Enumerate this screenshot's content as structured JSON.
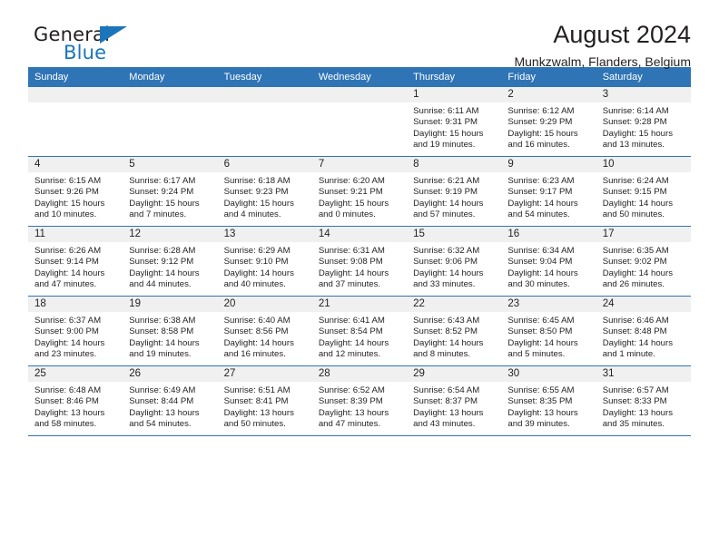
{
  "logo": {
    "text_top": "General",
    "text_bottom": "Blue",
    "triangle_color": "#1b75bb",
    "top_color": "#231f20",
    "bottom_color": "#1b75bb"
  },
  "header": {
    "title": "August 2024",
    "subtitle": "Munkzwalm, Flanders, Belgium"
  },
  "colors": {
    "header_blue": "#2f74b5",
    "daynum_band": "#f0f0f0",
    "text": "#231f20"
  },
  "weekday_headers": [
    "Sunday",
    "Monday",
    "Tuesday",
    "Wednesday",
    "Thursday",
    "Friday",
    "Saturday"
  ],
  "weeks": [
    [
      {
        "day": "",
        "empty": true,
        "sunrise": "",
        "sunset": "",
        "daylight": ""
      },
      {
        "day": "",
        "empty": true,
        "sunrise": "",
        "sunset": "",
        "daylight": ""
      },
      {
        "day": "",
        "empty": true,
        "sunrise": "",
        "sunset": "",
        "daylight": ""
      },
      {
        "day": "",
        "empty": true,
        "sunrise": "",
        "sunset": "",
        "daylight": ""
      },
      {
        "day": "1",
        "empty": false,
        "sunrise": "Sunrise: 6:11 AM",
        "sunset": "Sunset: 9:31 PM",
        "daylight": "Daylight: 15 hours and 19 minutes."
      },
      {
        "day": "2",
        "empty": false,
        "sunrise": "Sunrise: 6:12 AM",
        "sunset": "Sunset: 9:29 PM",
        "daylight": "Daylight: 15 hours and 16 minutes."
      },
      {
        "day": "3",
        "empty": false,
        "sunrise": "Sunrise: 6:14 AM",
        "sunset": "Sunset: 9:28 PM",
        "daylight": "Daylight: 15 hours and 13 minutes."
      }
    ],
    [
      {
        "day": "4",
        "empty": false,
        "sunrise": "Sunrise: 6:15 AM",
        "sunset": "Sunset: 9:26 PM",
        "daylight": "Daylight: 15 hours and 10 minutes."
      },
      {
        "day": "5",
        "empty": false,
        "sunrise": "Sunrise: 6:17 AM",
        "sunset": "Sunset: 9:24 PM",
        "daylight": "Daylight: 15 hours and 7 minutes."
      },
      {
        "day": "6",
        "empty": false,
        "sunrise": "Sunrise: 6:18 AM",
        "sunset": "Sunset: 9:23 PM",
        "daylight": "Daylight: 15 hours and 4 minutes."
      },
      {
        "day": "7",
        "empty": false,
        "sunrise": "Sunrise: 6:20 AM",
        "sunset": "Sunset: 9:21 PM",
        "daylight": "Daylight: 15 hours and 0 minutes."
      },
      {
        "day": "8",
        "empty": false,
        "sunrise": "Sunrise: 6:21 AM",
        "sunset": "Sunset: 9:19 PM",
        "daylight": "Daylight: 14 hours and 57 minutes."
      },
      {
        "day": "9",
        "empty": false,
        "sunrise": "Sunrise: 6:23 AM",
        "sunset": "Sunset: 9:17 PM",
        "daylight": "Daylight: 14 hours and 54 minutes."
      },
      {
        "day": "10",
        "empty": false,
        "sunrise": "Sunrise: 6:24 AM",
        "sunset": "Sunset: 9:15 PM",
        "daylight": "Daylight: 14 hours and 50 minutes."
      }
    ],
    [
      {
        "day": "11",
        "empty": false,
        "sunrise": "Sunrise: 6:26 AM",
        "sunset": "Sunset: 9:14 PM",
        "daylight": "Daylight: 14 hours and 47 minutes."
      },
      {
        "day": "12",
        "empty": false,
        "sunrise": "Sunrise: 6:28 AM",
        "sunset": "Sunset: 9:12 PM",
        "daylight": "Daylight: 14 hours and 44 minutes."
      },
      {
        "day": "13",
        "empty": false,
        "sunrise": "Sunrise: 6:29 AM",
        "sunset": "Sunset: 9:10 PM",
        "daylight": "Daylight: 14 hours and 40 minutes."
      },
      {
        "day": "14",
        "empty": false,
        "sunrise": "Sunrise: 6:31 AM",
        "sunset": "Sunset: 9:08 PM",
        "daylight": "Daylight: 14 hours and 37 minutes."
      },
      {
        "day": "15",
        "empty": false,
        "sunrise": "Sunrise: 6:32 AM",
        "sunset": "Sunset: 9:06 PM",
        "daylight": "Daylight: 14 hours and 33 minutes."
      },
      {
        "day": "16",
        "empty": false,
        "sunrise": "Sunrise: 6:34 AM",
        "sunset": "Sunset: 9:04 PM",
        "daylight": "Daylight: 14 hours and 30 minutes."
      },
      {
        "day": "17",
        "empty": false,
        "sunrise": "Sunrise: 6:35 AM",
        "sunset": "Sunset: 9:02 PM",
        "daylight": "Daylight: 14 hours and 26 minutes."
      }
    ],
    [
      {
        "day": "18",
        "empty": false,
        "sunrise": "Sunrise: 6:37 AM",
        "sunset": "Sunset: 9:00 PM",
        "daylight": "Daylight: 14 hours and 23 minutes."
      },
      {
        "day": "19",
        "empty": false,
        "sunrise": "Sunrise: 6:38 AM",
        "sunset": "Sunset: 8:58 PM",
        "daylight": "Daylight: 14 hours and 19 minutes."
      },
      {
        "day": "20",
        "empty": false,
        "sunrise": "Sunrise: 6:40 AM",
        "sunset": "Sunset: 8:56 PM",
        "daylight": "Daylight: 14 hours and 16 minutes."
      },
      {
        "day": "21",
        "empty": false,
        "sunrise": "Sunrise: 6:41 AM",
        "sunset": "Sunset: 8:54 PM",
        "daylight": "Daylight: 14 hours and 12 minutes."
      },
      {
        "day": "22",
        "empty": false,
        "sunrise": "Sunrise: 6:43 AM",
        "sunset": "Sunset: 8:52 PM",
        "daylight": "Daylight: 14 hours and 8 minutes."
      },
      {
        "day": "23",
        "empty": false,
        "sunrise": "Sunrise: 6:45 AM",
        "sunset": "Sunset: 8:50 PM",
        "daylight": "Daylight: 14 hours and 5 minutes."
      },
      {
        "day": "24",
        "empty": false,
        "sunrise": "Sunrise: 6:46 AM",
        "sunset": "Sunset: 8:48 PM",
        "daylight": "Daylight: 14 hours and 1 minute."
      }
    ],
    [
      {
        "day": "25",
        "empty": false,
        "sunrise": "Sunrise: 6:48 AM",
        "sunset": "Sunset: 8:46 PM",
        "daylight": "Daylight: 13 hours and 58 minutes."
      },
      {
        "day": "26",
        "empty": false,
        "sunrise": "Sunrise: 6:49 AM",
        "sunset": "Sunset: 8:44 PM",
        "daylight": "Daylight: 13 hours and 54 minutes."
      },
      {
        "day": "27",
        "empty": false,
        "sunrise": "Sunrise: 6:51 AM",
        "sunset": "Sunset: 8:41 PM",
        "daylight": "Daylight: 13 hours and 50 minutes."
      },
      {
        "day": "28",
        "empty": false,
        "sunrise": "Sunrise: 6:52 AM",
        "sunset": "Sunset: 8:39 PM",
        "daylight": "Daylight: 13 hours and 47 minutes."
      },
      {
        "day": "29",
        "empty": false,
        "sunrise": "Sunrise: 6:54 AM",
        "sunset": "Sunset: 8:37 PM",
        "daylight": "Daylight: 13 hours and 43 minutes."
      },
      {
        "day": "30",
        "empty": false,
        "sunrise": "Sunrise: 6:55 AM",
        "sunset": "Sunset: 8:35 PM",
        "daylight": "Daylight: 13 hours and 39 minutes."
      },
      {
        "day": "31",
        "empty": false,
        "sunrise": "Sunrise: 6:57 AM",
        "sunset": "Sunset: 8:33 PM",
        "daylight": "Daylight: 13 hours and 35 minutes."
      }
    ]
  ]
}
